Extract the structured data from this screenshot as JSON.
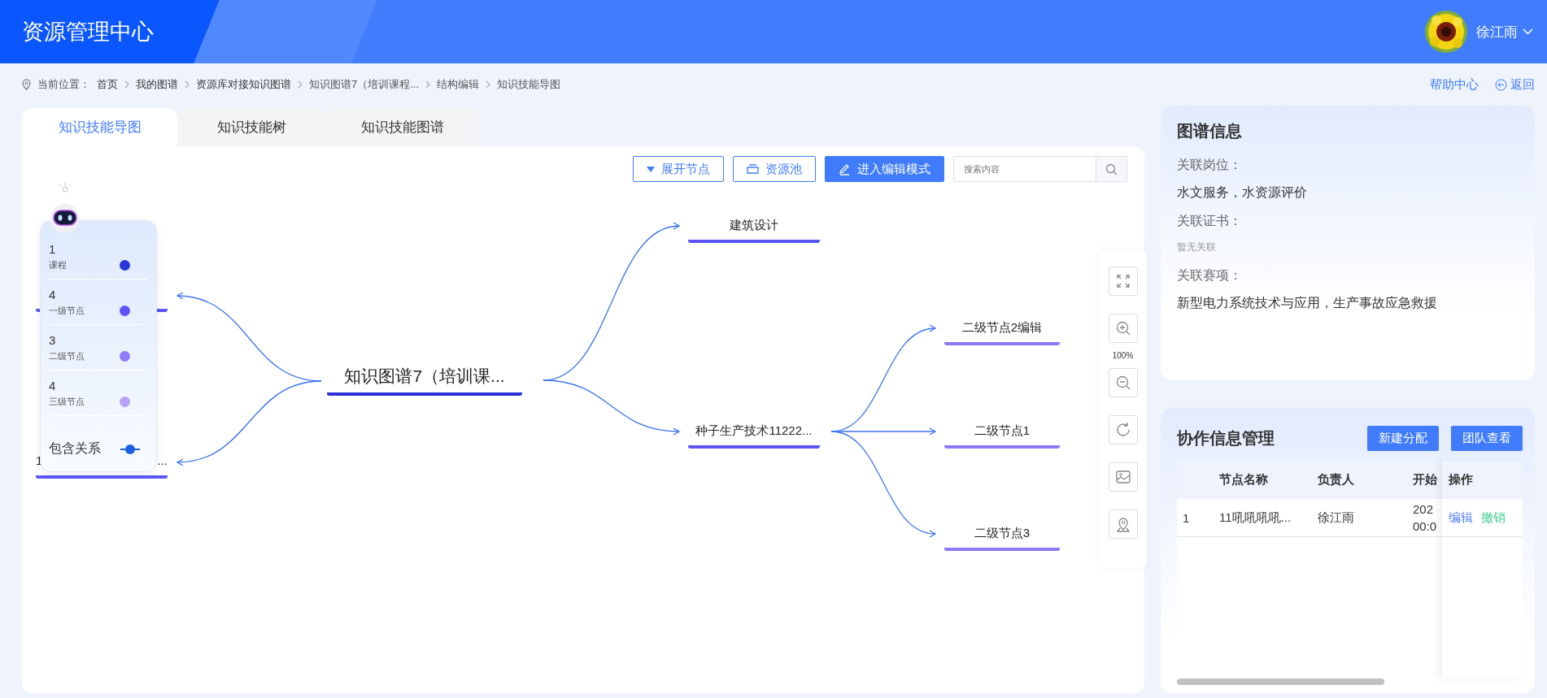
{
  "header": {
    "title": "资源管理中心",
    "user": {
      "name": "徐江雨"
    }
  },
  "breadcrumb": {
    "prefix": "当前位置：",
    "items": [
      "首页",
      "我的图谱",
      "资源库对接知识图谱",
      "知识图谱7（培训课程...",
      "结构编辑",
      "知识技能导图"
    ]
  },
  "top_links": {
    "help": "帮助中心",
    "back": "返回"
  },
  "tabs": [
    {
      "label": "知识技能导图",
      "selected": true
    },
    {
      "label": "知识技能树",
      "selected": false
    },
    {
      "label": "知识技能图谱",
      "selected": false
    }
  ],
  "toolbar": {
    "buttons": [
      {
        "label": "展开节点",
        "kind": "outline"
      },
      {
        "label": "资源池",
        "kind": "outline"
      },
      {
        "label": "进入编辑模式",
        "kind": "primary"
      }
    ],
    "search": {
      "placeholder": "搜索内容"
    }
  },
  "mind_map": {
    "root": {
      "label": "知识图谱7（培训课...",
      "color": "#2b30d8"
    },
    "left": [
      {
        "color": "#5b55f6"
      },
      {
        "label_head": "1",
        "label_tail": "...",
        "color": "#5b55f6"
      }
    ],
    "right": [
      {
        "label": "建筑设计",
        "color": "#5b55f6"
      },
      {
        "label": "种子生产技术11222...",
        "color": "#5b55f6",
        "children": [
          {
            "label": "二级节点2编辑",
            "color": "#8a79f7"
          },
          {
            "label": "二级节点1",
            "color": "#8a79f7"
          },
          {
            "label": "二级节点3",
            "color": "#8a79f7"
          }
        ]
      }
    ]
  },
  "legend": {
    "items": [
      {
        "count": "1",
        "label": "课程",
        "color": "#2b35d8"
      },
      {
        "count": "4",
        "label": "一级节点",
        "color": "#5f55f5"
      },
      {
        "count": "3",
        "label": "二级节点",
        "color": "#8f7cf7"
      },
      {
        "count": "4",
        "label": "三级节点",
        "color": "#b9a3f8"
      }
    ],
    "relation": {
      "label": "包含关系"
    }
  },
  "zoom_controls": {
    "reading": "100%"
  },
  "info_card": {
    "title": "图谱信息",
    "fields": [
      {
        "label": "关联岗位：",
        "value": "水文服务，水资源评价",
        "empty": false
      },
      {
        "label": "关联证书：",
        "value": "暂无关联",
        "empty": true
      },
      {
        "label": "关联赛项：",
        "value": "新型电力系统技术与应用，生产事故应急救援",
        "empty": false
      }
    ]
  },
  "collab_card": {
    "title": "协作信息管理",
    "buttons": [
      "新建分配",
      "团队查看"
    ],
    "table": {
      "columns": [
        "节点名称",
        "负责人",
        "开始"
      ],
      "actions_column": "操作",
      "rows": [
        {
          "index": "1",
          "node_name": "11吼吼吼吼...",
          "owner": "徐江雨",
          "start": [
            "202",
            "00:0"
          ],
          "actions": [
            {
              "label": "编辑",
              "kind": "edit"
            },
            {
              "label": "撤销",
              "kind": "revoke"
            }
          ]
        }
      ]
    }
  }
}
